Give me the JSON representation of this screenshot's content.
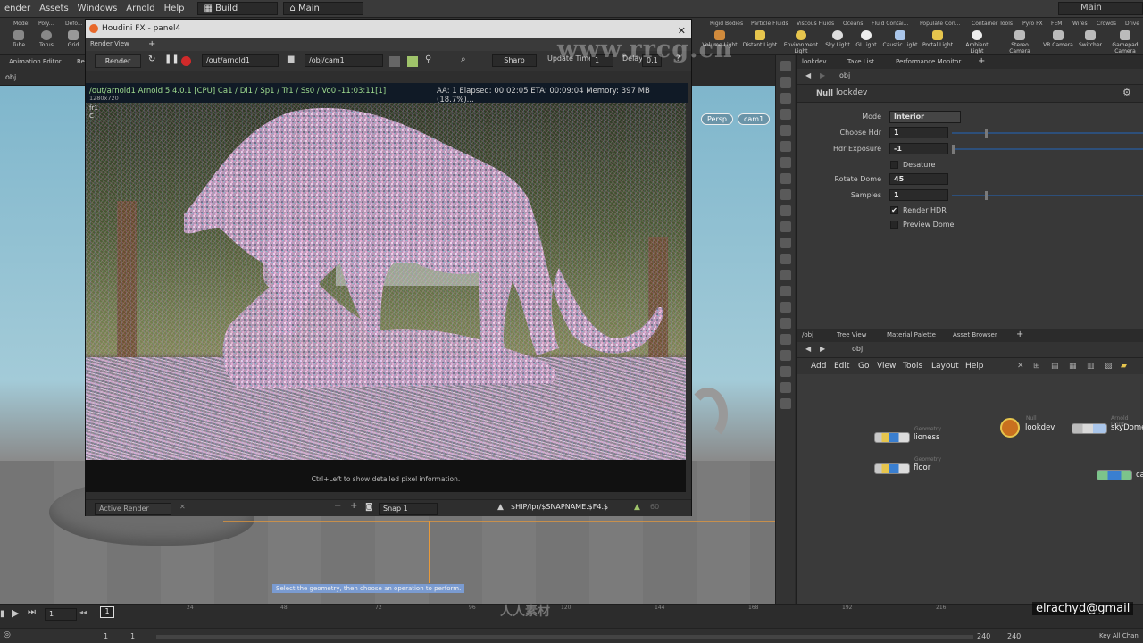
{
  "menubar": {
    "items": [
      "ender",
      "Assets",
      "Windows",
      "Arnold",
      "Help"
    ],
    "desktop_build": "Build",
    "desktop_main": "Main",
    "desktop_main_right": "Main"
  },
  "shelf": {
    "left_tabs": [
      "Model",
      "Poly...",
      "Defo..."
    ],
    "left_tools": [
      "Tube",
      "Torus",
      "Grid"
    ],
    "right_tabs": [
      "Rigid Bodies",
      "Particle Fluids",
      "Viscous Fluids",
      "Oceans",
      "Fluid Contai...",
      "Populate Con...",
      "Container Tools",
      "Pyro FX",
      "FEM",
      "Wires",
      "Crowds",
      "Drive"
    ],
    "right_tools": [
      "Volume Light",
      "Distant Light",
      "Environment Light",
      "Sky Light",
      "GI Light",
      "Caustic Light",
      "Portal Light",
      "Ambient Light",
      "Stereo Camera",
      "VR Camera",
      "Switcher",
      "Gamepad Camera"
    ]
  },
  "left_panel": {
    "tab": "Animation Editor",
    "tab2": "Re",
    "path": "obj"
  },
  "render_window": {
    "title": "Houdini FX - panel4",
    "tab": "Render View",
    "render_button": "Render",
    "rop_path": "/out/arnold1",
    "camera_path": "/obj/cam1",
    "filter": "Sharp",
    "update_time_label": "Update Time",
    "update_time_value": "1",
    "delay_label": "Delay",
    "delay_value": "0.1",
    "stats_path": "/out/arnold1  Arnold 5.4.0.1 [CPU] Ca1 / Di1 / Sp1 / Tr1 / Ss0 / Vo0 -11:03:11[1]",
    "stats_nums": "AA: 1   Elapsed: 00:02:05   ETA: 00:09:04   Memory: 397 MB   (18.7%)...",
    "resolution": "1280x720",
    "frame_label": "fr1",
    "channel_label": "C",
    "hint": "Ctrl+Left to show detailed pixel information.",
    "status_active": "Active Render",
    "snap_label": "Snap 1",
    "snap_path": "$HIP/ipr/$SNAPNAME.$F4.$",
    "snap_num": "60"
  },
  "viewport": {
    "persp_label": "Persp",
    "cam_label": "cam1",
    "hint": "Select the geometry, then choose an operation to perform."
  },
  "param_pane": {
    "tabs": [
      "lookdev",
      "Take List",
      "Performance Monitor"
    ],
    "path": "obj",
    "node_type": "Null",
    "node_name": "lookdev",
    "mode_label": "Mode",
    "mode_value": "Interior",
    "params": [
      {
        "label": "Choose Hdr",
        "value": "1",
        "fill": 0.17
      },
      {
        "label": "Hdr Exposure",
        "value": "-1",
        "fill": 0.0
      }
    ],
    "desature_label": "Desature",
    "rotate_label": "Rotate Dome",
    "rotate_value": "45",
    "samples_label": "Samples",
    "samples_value": "1",
    "samples_fill": 0.17,
    "render_hdr_label": "Render HDR",
    "render_hdr_checked": "✔",
    "preview_dome_label": "Preview Dome"
  },
  "net_pane": {
    "tabs": [
      "/obj",
      "Tree View",
      "Material Palette",
      "Asset Browser"
    ],
    "path": "obj",
    "menu": [
      "Add",
      "Edit",
      "Go",
      "View",
      "Tools",
      "Layout",
      "Help"
    ],
    "nodes": [
      {
        "type": "Geometry",
        "name": "lioness"
      },
      {
        "type": "Geometry",
        "name": "floor"
      },
      {
        "type": "Null",
        "name": "lookdev"
      },
      {
        "type": "Arnold Light",
        "name": "skyDome"
      },
      {
        "type": "",
        "name": "ca"
      }
    ]
  },
  "timeline": {
    "ticks": [
      "24",
      "48",
      "72",
      "96",
      "120",
      "144",
      "168",
      "192",
      "216"
    ],
    "current_frame": "1",
    "frame_field": "1",
    "start": "1",
    "start2": "1",
    "end": "240",
    "end2": "240",
    "keys_label": "Key All Chan"
  },
  "watermark": "www.rrcg.cn",
  "watermark2": "人人素材",
  "username": "elrachyd@gmail",
  "colors": {
    "accent": "#e8682a",
    "slider": "#2d4f7a",
    "stats_bg": "#101a26"
  }
}
